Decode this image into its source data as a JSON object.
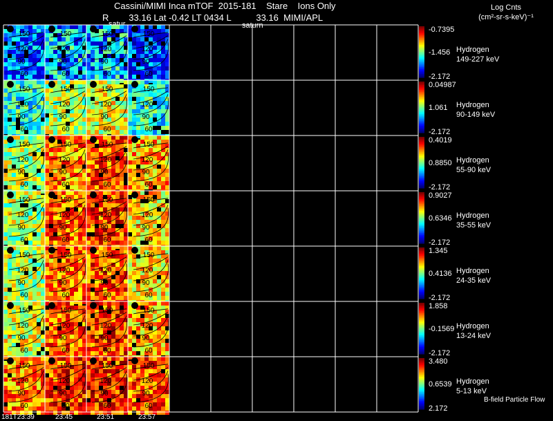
{
  "header": {
    "title_line1": "Cassini/MIMI Inca mTOF  2015-181    Stare    Ions Only",
    "title_line2": "R        33.16 Lat -0.42 LT 0434 L          33.16  MIMI/APL",
    "saturn_label_1": "satur",
    "saturn_label_2": "saturn",
    "units_line1": "Log Cnts",
    "units_line2": "(cm²-sr-s-keV)⁻¹"
  },
  "footer": {
    "time_labels": [
      "181T23:39",
      "23:45",
      "23:51",
      "23:57"
    ],
    "bfield_label": "B-field Particle Flow"
  },
  "chart_data": {
    "type": "heatmap",
    "title": "Cassini/MIMI Inca mTOF  2015-181",
    "times": [
      "181T23:39",
      "23:45",
      "23:51",
      "23:57"
    ],
    "contour_labels": [
      "150",
      "120",
      "90",
      "60"
    ],
    "rows": [
      {
        "species": "Hydrogen",
        "energy": "149-227 keV",
        "max": "-0.7395",
        "mid": "-1.456",
        "min": "-2.172",
        "intensity": [
          0.25,
          0.35,
          0.35,
          0.2
        ]
      },
      {
        "species": "Hydrogen",
        "energy": "90-149 keV",
        "max": "0.04987",
        "mid": "1.061",
        "min": "-2.172",
        "intensity": [
          0.4,
          0.55,
          0.6,
          0.4
        ]
      },
      {
        "species": "Hydrogen",
        "energy": "55-90 keV",
        "max": "0.4019",
        "mid": "0.8850",
        "min": "-2.172",
        "intensity": [
          0.55,
          0.75,
          0.8,
          0.7
        ]
      },
      {
        "species": "Hydrogen",
        "energy": "35-55 keV",
        "max": "0.9027",
        "mid": "0.6346",
        "min": "-2.172",
        "intensity": [
          0.55,
          0.78,
          0.82,
          0.65
        ]
      },
      {
        "species": "Hydrogen",
        "energy": "24-35 keV",
        "max": "1.345",
        "mid": "0.4136",
        "min": "-2.172",
        "intensity": [
          0.55,
          0.75,
          0.8,
          0.65
        ]
      },
      {
        "species": "Hydrogen",
        "energy": "13-24 keV",
        "max": "1.858",
        "mid": "-0.1569",
        "min": "-2.172",
        "intensity": [
          0.6,
          0.78,
          0.82,
          0.7
        ]
      },
      {
        "species": "Hydrogen",
        "energy": "5-13 keV",
        "max": "3.480",
        "mid": "0.6539",
        "min": "2.172",
        "intensity": [
          0.75,
          0.82,
          0.85,
          0.8
        ]
      }
    ]
  }
}
